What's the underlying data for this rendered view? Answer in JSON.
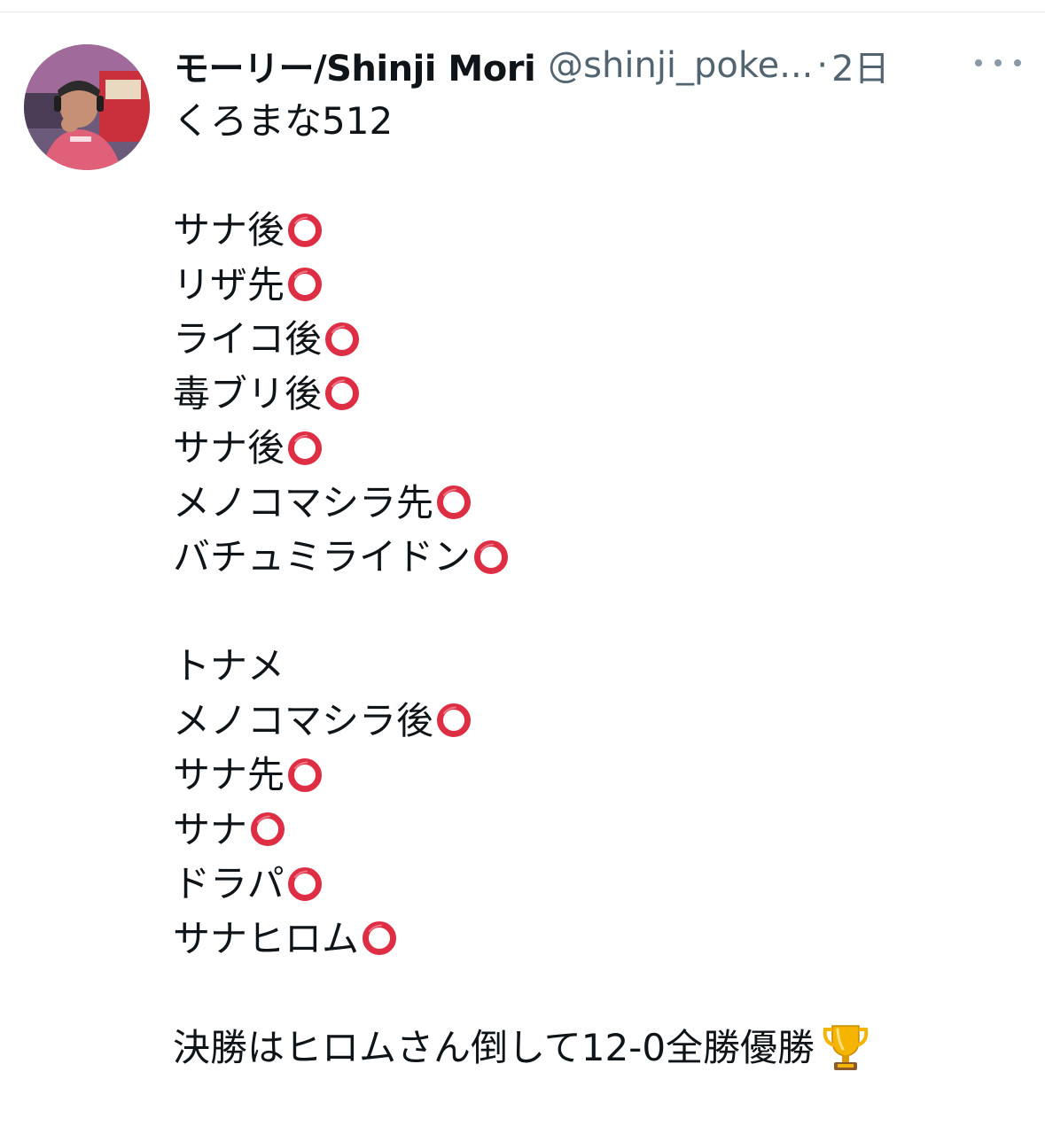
{
  "tweet": {
    "author": {
      "display_name": "モーリー/Shinji Mori",
      "handle": "@shinji_poke...",
      "separator": "·",
      "time": "2日",
      "avatar_icon": "user-avatar-photo"
    },
    "more_icon": "more-horizontal-icon",
    "lines": [
      {
        "text": "くろまな512",
        "ring": false
      },
      {
        "text": "",
        "ring": false
      },
      {
        "text": "サナ後",
        "ring": true
      },
      {
        "text": "リザ先",
        "ring": true
      },
      {
        "text": "ライコ後",
        "ring": true
      },
      {
        "text": "毒ブリ後",
        "ring": true
      },
      {
        "text": "サナ後",
        "ring": true
      },
      {
        "text": "メノコマシラ先",
        "ring": true
      },
      {
        "text": "バチュミライドン",
        "ring": true
      },
      {
        "text": "",
        "ring": false
      },
      {
        "text": "トナメ",
        "ring": false
      },
      {
        "text": "メノコマシラ後",
        "ring": true
      },
      {
        "text": "サナ先",
        "ring": true
      },
      {
        "text": "サナ",
        "ring": true
      },
      {
        "text": "ドラパ",
        "ring": true
      },
      {
        "text": "サナヒロム",
        "ring": true
      },
      {
        "text": "",
        "ring": false
      },
      {
        "text": "決勝はヒロムさん倒して12-0全勝優勝",
        "ring": false,
        "trophy": true
      }
    ],
    "emoji": {
      "ring": "heavy-large-circle-icon",
      "trophy": "trophy-icon"
    },
    "colors": {
      "ring_red": "#dd2e44",
      "secondary_text": "#536471",
      "primary_text": "#0f1419"
    }
  }
}
